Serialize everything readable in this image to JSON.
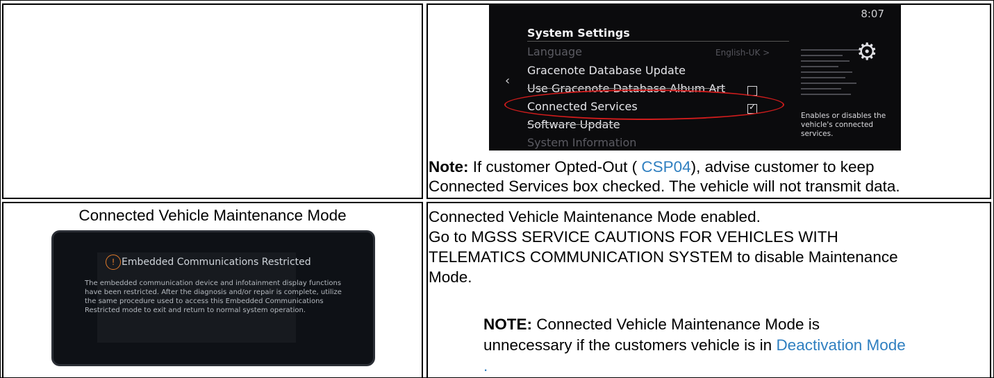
{
  "screen": {
    "time": "8:07",
    "header": "System Settings",
    "rows": [
      {
        "label": "Language",
        "value": "English-UK >",
        "dim": true
      },
      {
        "label": "Gracenote Database Update"
      },
      {
        "label": "Use Gracenote Database Album Art",
        "checked": false
      },
      {
        "label": "Connected Services",
        "checked": true
      },
      {
        "label": "Software Update"
      },
      {
        "label": "System Information",
        "dim": true
      }
    ],
    "description": "Enables or disables the vehicle's connected services.",
    "icons": {
      "back": "chevron-left-icon",
      "settings": "gear-icon",
      "check": "check-icon"
    },
    "highlight_color": "#d01c1c"
  },
  "note1": {
    "label": "Note:",
    "part1": " If customer Opted-Out ( ",
    "link": "CSP04",
    "part2": "), advise customer to keep",
    "line2": "Connected Services box checked. The vehicle will not transmit data."
  },
  "row2": {
    "left_title": "Connected Vehicle Maintenance Mode",
    "photo": {
      "title": "Embedded Communications Restricted",
      "body": "The embedded communication device and infotainment display functions have been restricted. After the diagnosis and/or repair is complete, utilize the same procedure used to access this Embedded Communications Restricted mode to exit and return to normal system operation.",
      "icon": "warning-icon",
      "accent": "#e07a2a"
    },
    "line1": "Connected Vehicle Maintenance Mode enabled.",
    "line2": "Go to MGSS SERVICE CAUTIONS FOR VEHICLES WITH",
    "line3": "TELEMATICS COMMUNICATION SYSTEM to disable Maintenance",
    "line4": "Mode.",
    "note_label": "NOTE:",
    "note_text1": " Connected Vehicle Maintenance Mode is",
    "note_text2": "unnecessary if the customers vehicle is in ",
    "note_link": "Deactivation Mode",
    "note_end": "."
  },
  "colors": {
    "link": "#2f7fc0"
  }
}
